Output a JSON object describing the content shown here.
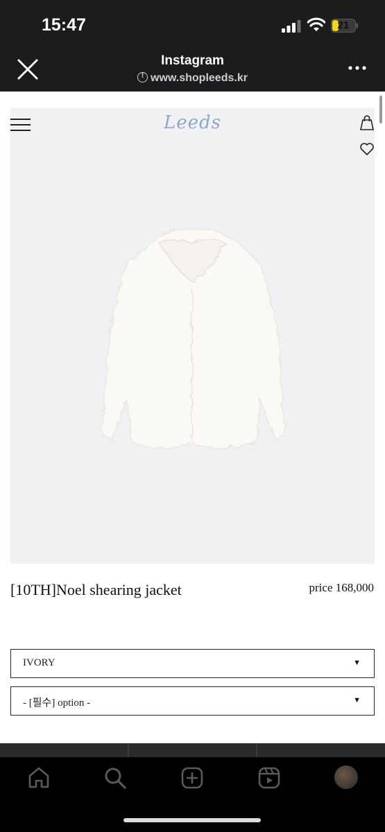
{
  "status_bar": {
    "time": "15:47",
    "battery": "21"
  },
  "browser": {
    "title": "Instagram",
    "url": "www.shopleeds.kr"
  },
  "site": {
    "logo": "Leeds"
  },
  "product": {
    "name": "[10TH]Noel shearing jacket",
    "price": "price 168,000",
    "color_select": {
      "value": "IVORY"
    },
    "option_select": {
      "value": "- [필수] option -"
    }
  },
  "icons": {
    "close": "close-icon",
    "more": "more-icon",
    "menu": "hamburger-icon",
    "cart": "shopping-bag-icon",
    "wishlist": "heart-icon",
    "nav": [
      "home-icon",
      "search-icon",
      "create-icon",
      "reels-icon",
      "profile-avatar"
    ]
  },
  "colors": {
    "logo": "#8fa7c9",
    "dark_bg": "#1c1c1e",
    "battery_fill": "#f5d70a"
  }
}
